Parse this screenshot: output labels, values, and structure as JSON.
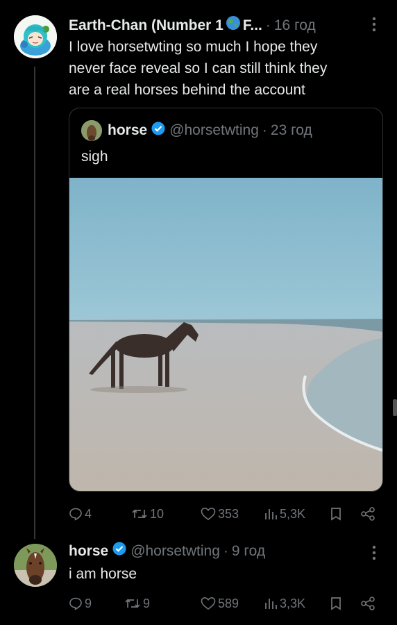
{
  "reply_post": {
    "display_name": "Earth-Chan (Number 1",
    "name_suffix": "F...",
    "separator": "·",
    "time": "16 год",
    "text_lines": [
      "I love horsetwting so much I hope they",
      "never face reveal so I can still think they",
      "are a real horses behind the account"
    ],
    "more_icon": "more-dots-icon",
    "quote": {
      "display_name": "horse",
      "handle": "@horsetwting",
      "separator": "·",
      "time": "23 год",
      "text": "sigh",
      "media_alt": "horse standing on a beach"
    },
    "actions": {
      "replies": "4",
      "reposts": "10",
      "likes": "353",
      "views": "5,3K"
    }
  },
  "main_post": {
    "display_name": "horse",
    "handle": "@horsetwting",
    "separator": "·",
    "time": "9 год",
    "text": "i am horse",
    "actions": {
      "replies": "9",
      "reposts": "9",
      "likes": "589",
      "views": "3,3K"
    }
  },
  "colors": {
    "background": "#000000",
    "text": "#e7e9ea",
    "muted": "#71767b",
    "verified": "#1d9bf0"
  }
}
